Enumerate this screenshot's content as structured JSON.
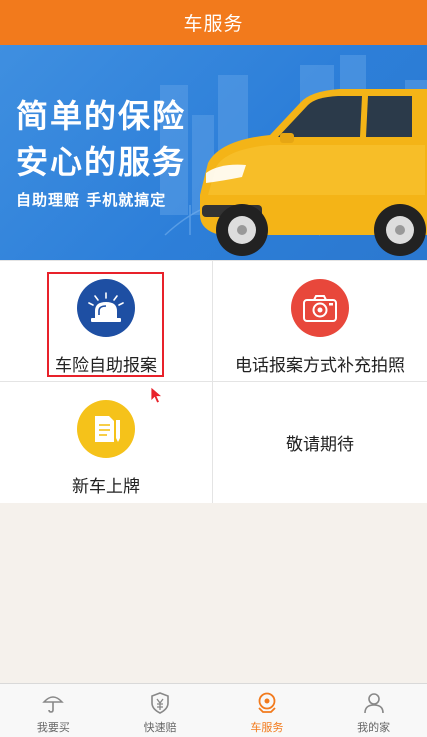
{
  "header": {
    "title": "车服务"
  },
  "banner": {
    "line1": "简单的保险",
    "line2": "安心的服务",
    "line3": "自助理赔 手机就搞定"
  },
  "services": [
    {
      "label": "车险自助报案",
      "icon": "alarm-light-icon",
      "color": "#1e4fa3"
    },
    {
      "label": "电话报案方式补充拍照",
      "icon": "camera-icon",
      "color": "#e8473b"
    },
    {
      "label": "新车上牌",
      "icon": "document-pen-icon",
      "color": "#f5c21a"
    },
    {
      "label": "敬请期待"
    }
  ],
  "tabs": [
    {
      "label": "我要买",
      "icon": "umbrella-icon"
    },
    {
      "label": "快速赔",
      "icon": "yuan-shield-icon"
    },
    {
      "label": "车服务",
      "icon": "car-service-icon",
      "active": true
    },
    {
      "label": "我的家",
      "icon": "person-icon"
    }
  ],
  "colors": {
    "brand": "#f27a1c",
    "highlight": "#e8212a",
    "banner": "#2d7fd9"
  }
}
